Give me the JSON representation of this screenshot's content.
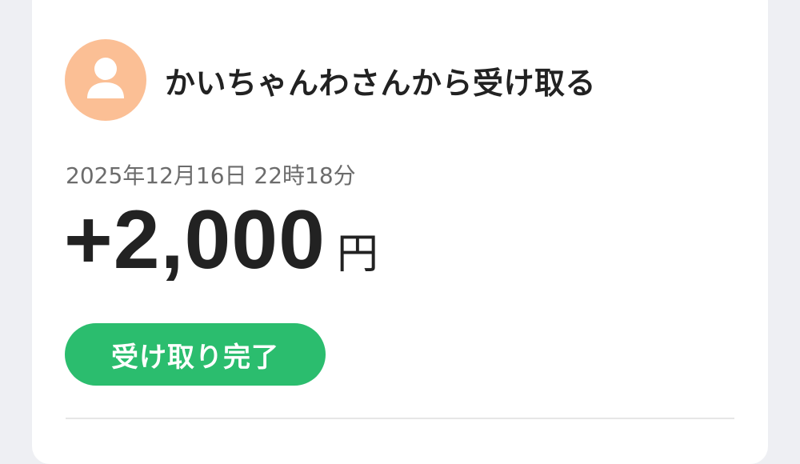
{
  "transaction": {
    "title": "かいちゃんわさんから受け取る",
    "datetime": "2025年12月16日 22時18分",
    "amount": "+2,000",
    "currency": "円",
    "status": "受け取り完了"
  },
  "colors": {
    "avatar_bg": "#fbbf95",
    "avatar_figure": "#ffffff",
    "status_bg": "#2bbd6e",
    "page_bg": "#eeeff3",
    "card_bg": "#ffffff",
    "text_primary": "#222222",
    "text_secondary": "#6c6c6c"
  },
  "icons": {
    "avatar": "user-silhouette-icon"
  }
}
